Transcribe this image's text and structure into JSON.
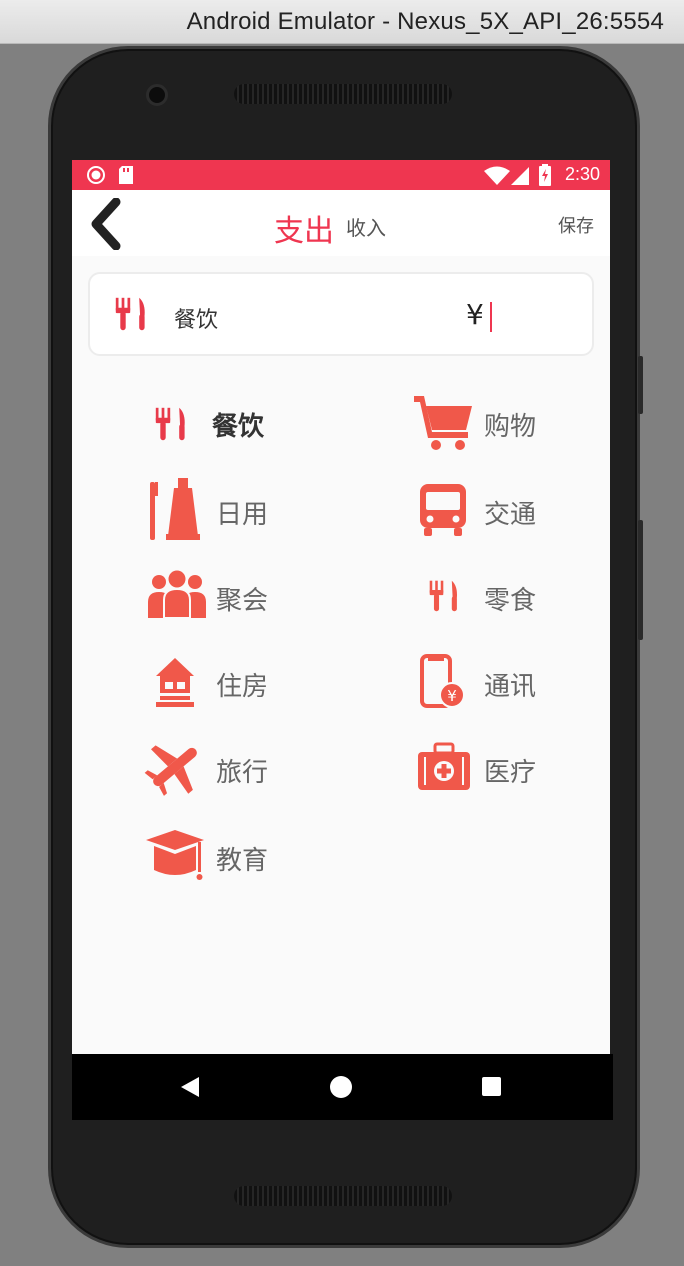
{
  "window": {
    "title": "Android Emulator - Nexus_5X_API_26:5554"
  },
  "statusbar": {
    "time": "2:30",
    "color": "#ef3650"
  },
  "appbar": {
    "back_icon": "chevron-left-icon",
    "tab_expense": "支出",
    "tab_income": "收入",
    "save": "保存"
  },
  "input": {
    "category": "餐饮",
    "currency": "¥",
    "amount": "",
    "icon": "fork-knife-icon"
  },
  "accent": "#f0584a",
  "categories": [
    {
      "label": "餐饮",
      "icon": "fork-knife-icon",
      "selected": true
    },
    {
      "label": "购物",
      "icon": "shopping-cart-icon"
    },
    {
      "label": "日用",
      "icon": "toothbrush-icon"
    },
    {
      "label": "交通",
      "icon": "bus-icon"
    },
    {
      "label": "聚会",
      "icon": "people-icon"
    },
    {
      "label": "零食",
      "icon": "fork-knife-icon"
    },
    {
      "label": "住房",
      "icon": "house-icon"
    },
    {
      "label": "通讯",
      "icon": "phone-bill-icon"
    },
    {
      "label": "旅行",
      "icon": "airplane-icon"
    },
    {
      "label": "医疗",
      "icon": "medical-kit-icon"
    },
    {
      "label": "教育",
      "icon": "graduation-cap-icon"
    }
  ]
}
